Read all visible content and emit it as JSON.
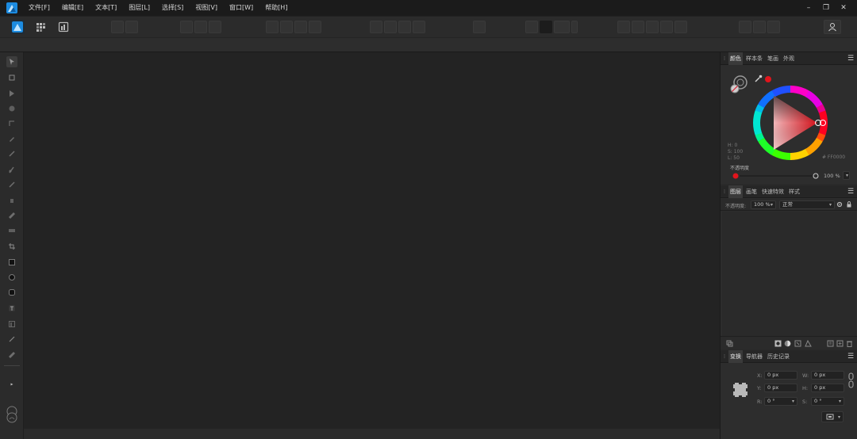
{
  "menu": [
    "文件[F]",
    "编辑[E]",
    "文本[T]",
    "图层[L]",
    "选择[S]",
    "视图[V]",
    "窗口[W]",
    "帮助[H]"
  ],
  "window_controls": {
    "minimize": "–",
    "maximize": "❐",
    "close": "✕"
  },
  "color_panel": {
    "tabs": [
      "颜色",
      "样本条",
      "笔画",
      "外观"
    ],
    "active_tab": 0,
    "readouts": {
      "h": "H: 0",
      "s": "S: 100",
      "l": "L: 50",
      "hex": "# FF0000"
    },
    "opacity_label": "不透明度",
    "opacity_value": "100 %",
    "current_color": "#e1141c"
  },
  "layers_panel": {
    "tabs": [
      "图层",
      "画笔",
      "快速特效",
      "样式"
    ],
    "active_tab": 0,
    "opacity_label": "不透明度:",
    "opacity_value": "100 %",
    "blend_mode": "正常"
  },
  "transform_panel": {
    "tabs": [
      "变换",
      "导航器",
      "历史记录"
    ],
    "active_tab": 0,
    "fields": {
      "x_label": "X:",
      "x_value": "0 px",
      "w_label": "W:",
      "w_value": "0 px",
      "y_label": "Y:",
      "y_value": "0 px",
      "h_label": "H:",
      "h_value": "0 px",
      "r_label": "R:",
      "r_value": "0 °",
      "s_label": "S:",
      "s_value": "0 °"
    }
  },
  "icons": {
    "persona_designer": "designer-persona-icon",
    "persona_pixel": "pixel-persona-icon",
    "persona_export": "export-persona-icon",
    "user": "user-icon"
  }
}
